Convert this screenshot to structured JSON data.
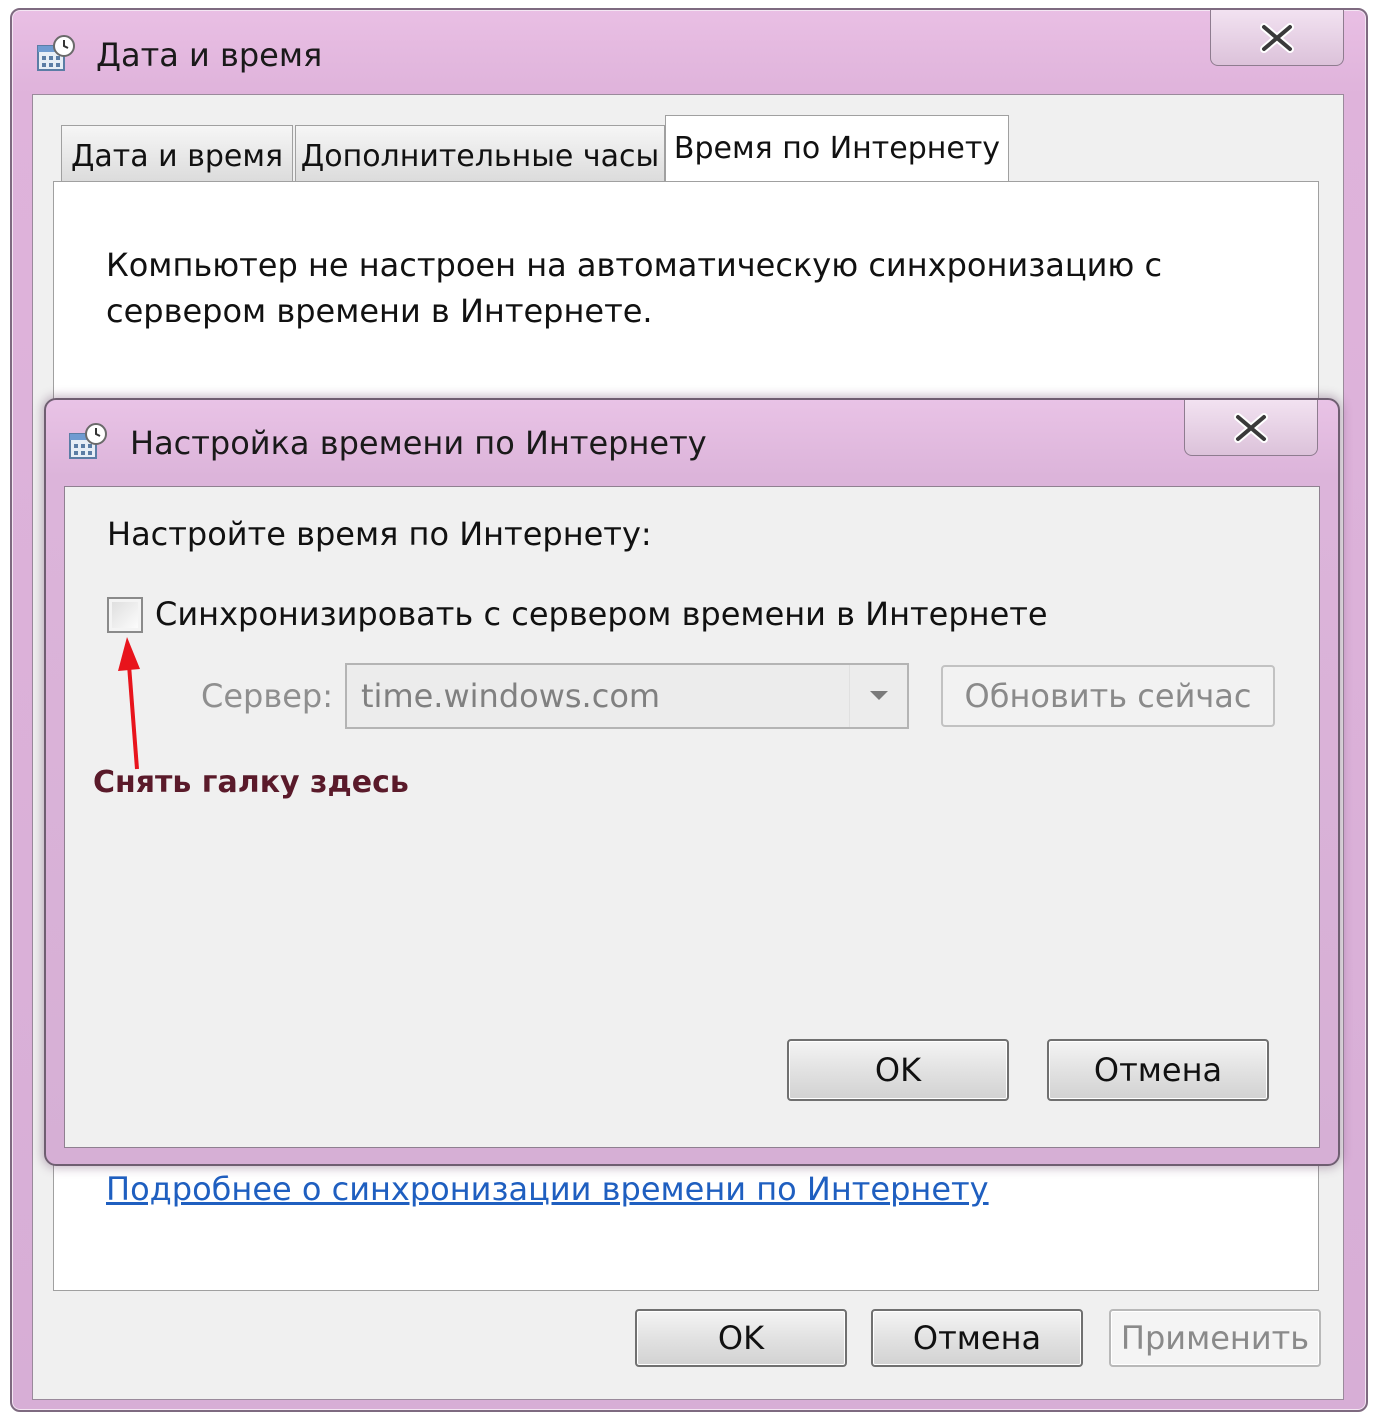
{
  "outer_window": {
    "title": "Дата и время",
    "tabs": [
      {
        "label": "Дата и время"
      },
      {
        "label": "Дополнительные часы"
      },
      {
        "label": "Время по Интернету"
      }
    ],
    "status_text": "Компьютер не настроен на автоматическую синхронизацию с сервером времени в Интернете.",
    "more_link": "Подробнее о синхронизации времени по Интернету",
    "buttons": {
      "ok": "OK",
      "cancel": "Отмена",
      "apply": "Применить"
    }
  },
  "inner_dialog": {
    "title": "Настройка времени по Интернету",
    "prompt": "Настройте время по Интернету:",
    "sync_checkbox_label": "Синхронизировать с сервером времени в Интернете",
    "sync_checked": false,
    "server_label": "Сервер:",
    "server_value": "time.windows.com",
    "update_button": "Обновить сейчас",
    "buttons": {
      "ok": "OK",
      "cancel": "Отмена"
    }
  },
  "annotation": {
    "text": "Снять галку здесь",
    "color": "#e8141c"
  },
  "icons": {
    "window": "calendar-clock-icon",
    "close": "close-icon",
    "dropdown": "chevron-down-icon"
  }
}
